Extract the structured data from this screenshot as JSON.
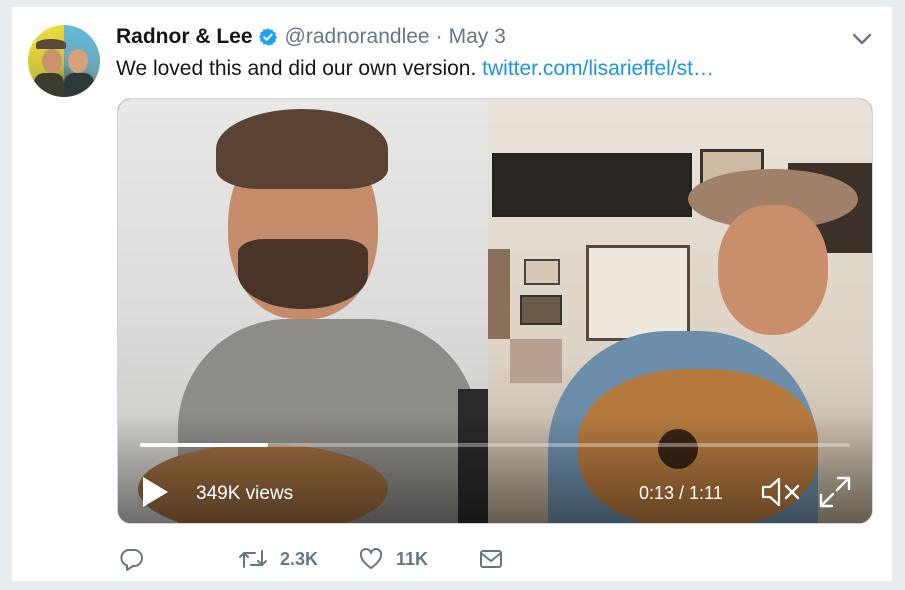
{
  "tweet": {
    "author_name": "Radnor & Lee",
    "handle": "@radnorandlee",
    "separator": "·",
    "date": "May 3",
    "text": "We loved this and did our own version.",
    "link_text": "twitter.com/lisarieffel/st…"
  },
  "video": {
    "views": "349K views",
    "time": "0:13 / 1:11",
    "progress_fraction": 0.18
  },
  "actions": {
    "reply_count": "",
    "retweet_count": "2.3K",
    "like_count": "11K"
  },
  "colors": {
    "link": "#1b95e0",
    "verified": "#1da1f2",
    "muted_text": "#657786"
  },
  "icons": [
    "verified-badge-icon",
    "caret-down-icon",
    "play-icon",
    "volume-muted-icon",
    "fullscreen-icon",
    "reply-icon",
    "retweet-icon",
    "like-icon",
    "direct-message-icon"
  ]
}
